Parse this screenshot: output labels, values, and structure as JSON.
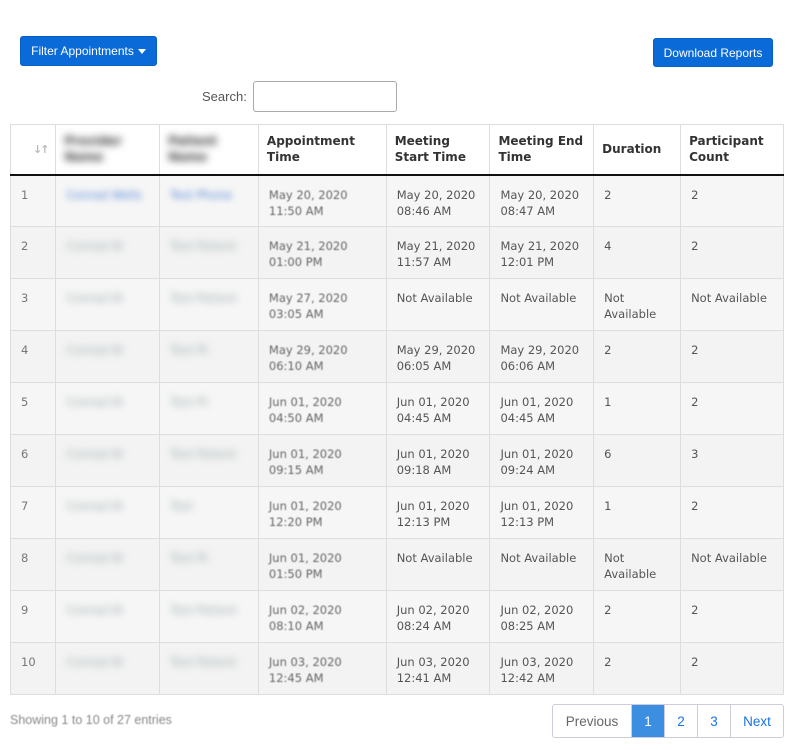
{
  "toolbar": {
    "filter_label": "Filter Appointments",
    "download_label": "Download Reports"
  },
  "search": {
    "label": "Search:",
    "value": ""
  },
  "table": {
    "headers": {
      "num": "",
      "provider": "Provider Name",
      "patient": "Patient Name",
      "appointment": "Appointment Time",
      "start": "Meeting Start Time",
      "end": "Meeting End Time",
      "duration": "Duration",
      "participants": "Participant Count"
    },
    "rows": [
      {
        "num": "1",
        "provider": "Conrad Wells",
        "patient": "Test Phone",
        "appt_date": "May 20, 2020",
        "appt_time": "11:50 AM",
        "start_date": "May 20, 2020",
        "start_time": "08:46 AM",
        "end_date": "May 20, 2020",
        "end_time": "08:47 AM",
        "duration": "2",
        "participants": "2"
      },
      {
        "num": "2",
        "provider": "Conrad W",
        "patient": "Test Patient",
        "appt_date": "May 21, 2020",
        "appt_time": "01:00 PM",
        "start_date": "May 21, 2020",
        "start_time": "11:57 AM",
        "end_date": "May 21, 2020",
        "end_time": "12:01 PM",
        "duration": "4",
        "participants": "2"
      },
      {
        "num": "3",
        "provider": "Conrad W",
        "patient": "Test Patient",
        "appt_date": "May 27, 2020",
        "appt_time": "03:05 AM",
        "start_date": "Not Available",
        "start_time": "",
        "end_date": "Not Available",
        "end_time": "",
        "duration": "Not Available",
        "participants": "Not Available"
      },
      {
        "num": "4",
        "provider": "Conrad W",
        "patient": "Test Pt",
        "appt_date": "May 29, 2020",
        "appt_time": "06:10 AM",
        "start_date": "May 29, 2020",
        "start_time": "06:05 AM",
        "end_date": "May 29, 2020",
        "end_time": "06:06 AM",
        "duration": "2",
        "participants": "2"
      },
      {
        "num": "5",
        "provider": "Conrad W",
        "patient": "Test Pt",
        "appt_date": "Jun 01, 2020",
        "appt_time": "04:50 AM",
        "start_date": "Jun 01, 2020",
        "start_time": "04:45 AM",
        "end_date": "Jun 01, 2020",
        "end_time": "04:45 AM",
        "duration": "1",
        "participants": "2"
      },
      {
        "num": "6",
        "provider": "Conrad W",
        "patient": "Test Patient",
        "appt_date": "Jun 01, 2020",
        "appt_time": "09:15 AM",
        "start_date": "Jun 01, 2020",
        "start_time": "09:18 AM",
        "end_date": "Jun 01, 2020",
        "end_time": "09:24 AM",
        "duration": "6",
        "participants": "3"
      },
      {
        "num": "7",
        "provider": "Conrad W",
        "patient": "Test",
        "appt_date": "Jun 01, 2020",
        "appt_time": "12:20 PM",
        "start_date": "Jun 01, 2020",
        "start_time": "12:13 PM",
        "end_date": "Jun 01, 2020",
        "end_time": "12:13 PM",
        "duration": "1",
        "participants": "2"
      },
      {
        "num": "8",
        "provider": "Conrad W",
        "patient": "Test Pt",
        "appt_date": "Jun 01, 2020",
        "appt_time": "01:50 PM",
        "start_date": "Not Available",
        "start_time": "",
        "end_date": "Not Available",
        "end_time": "",
        "duration": "Not Available",
        "participants": "Not Available"
      },
      {
        "num": "9",
        "provider": "Conrad W",
        "patient": "Test Patient",
        "appt_date": "Jun 02, 2020",
        "appt_time": "08:10 AM",
        "start_date": "Jun 02, 2020",
        "start_time": "08:24 AM",
        "end_date": "Jun 02, 2020",
        "end_time": "08:25 AM",
        "duration": "2",
        "participants": "2"
      },
      {
        "num": "10",
        "provider": "Conrad W",
        "patient": "Test Patient",
        "appt_date": "Jun 03, 2020",
        "appt_time": "12:45 AM",
        "start_date": "Jun 03, 2020",
        "start_time": "12:41 AM",
        "end_date": "Jun 03, 2020",
        "end_time": "12:42 AM",
        "duration": "2",
        "participants": "2"
      }
    ]
  },
  "footer": {
    "info": "Showing 1 to 10 of 27 entries",
    "pagination": {
      "prev": "Previous",
      "pages": [
        "1",
        "2",
        "3"
      ],
      "next": "Next",
      "current": "1"
    }
  },
  "icons": {
    "sort": "sort-icon",
    "caret": "caret-down-icon"
  },
  "colors": {
    "primary": "#0a6ad8",
    "active_page": "#3b8ee0",
    "link": "#1a73e8"
  }
}
